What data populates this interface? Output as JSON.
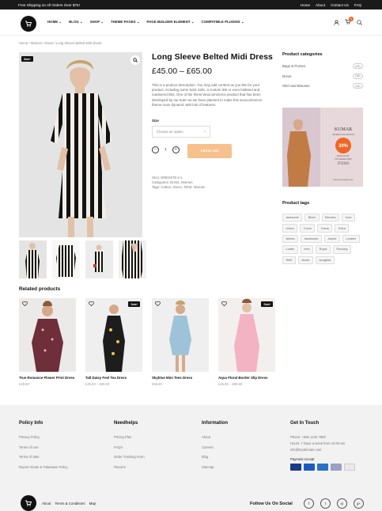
{
  "topbar": {
    "promo": "Free Shipping on All Orders Over $75!",
    "links": [
      "Home",
      "About",
      "Contact Us",
      "FAQ"
    ]
  },
  "nav": {
    "items": [
      "HOME",
      "BLOG",
      "SHOP",
      "THEME PAGES",
      "PAGE BUILDER ELEMENT",
      "COMPATIBLE PLUGINS"
    ],
    "cart_count": "0"
  },
  "breadcrumb": "Home / Women / Dress / Long Sleeve Belted Midi Dress",
  "product": {
    "sale_badge": "Sale!",
    "title": "Long Sleeve Belted Midi Dress",
    "price": "£45.00 – £65.00",
    "description": "This is a product description. You may add content as you like for your product, including some bold, italic, a custom link or even bulleted and numbered lists. One of the finest Woocommerce product that has been developed by our team as we have planned to make this woocommerce theme more dynamic with lots of features.",
    "size_label": "Size",
    "size_placeholder": "Choose an option",
    "qty": "1",
    "add_to_cart": "Add to cart",
    "sku": "SKU: DRESS75-2-1",
    "categories": "Categories: Dress, Women",
    "tags": "Tags: Cotton, Dress, Tshirt, Women"
  },
  "sidebar": {
    "categories_title": "Product categories",
    "categories": [
      {
        "name": "Bags & Purses",
        "count": "(29)"
      },
      {
        "name": "Dress",
        "count": "(16)"
      },
      {
        "name": "Shirt and Blouses",
        "count": "(16)"
      }
    ],
    "banner": {
      "brand": "KUMAR",
      "brand_sub": "WOMEN COLLECTION",
      "percent": "30%",
      "line1": "DISCOUNT",
      "line2": "ON SELECTED",
      "line3": "ITEMS",
      "url": "www.yourcompany.com"
    },
    "tags_title": "Product tags",
    "tags": [
      "awesome",
      "Black",
      "Blouses",
      "Cool",
      "cotton",
      "Curve",
      "Dress",
      "Extra",
      "fabrics",
      "handsome",
      "Jacket",
      "Leather",
      "Loafer",
      "men",
      "Royal",
      "Running",
      "Shirt",
      "shoes",
      "sunglass"
    ]
  },
  "related": {
    "title": "Related products",
    "items": [
      {
        "name": "True Romance Flower Print Dress",
        "price": "£49.69",
        "sale": false
      },
      {
        "name": "Tall Daisy Feel Tea Dress",
        "price": "£45.60 – £69.60",
        "sale": true
      },
      {
        "name": "Skyblue Mini Tees Dress",
        "price": "£58.60",
        "sale": false
      },
      {
        "name": "Aqua Floral Border Slip Dress",
        "price": "£45.60 – £69.60",
        "sale": true
      }
    ]
  },
  "footer": {
    "policy": {
      "title": "Policy Info",
      "items": [
        "Privacy Policy",
        "Terms of Use",
        "Terms of Sale",
        "Report Abuse & Takedown Policy"
      ]
    },
    "help": {
      "title": "Needhelps",
      "items": [
        "Pricing Plan",
        "FAQ's",
        "Order Tracking Form",
        "Returns"
      ]
    },
    "info": {
      "title": "Information",
      "items": [
        "About",
        "Careers",
        "Blog",
        "Sitemap"
      ]
    },
    "touch": {
      "title": "Get In Touch",
      "phone": "Phone: +555 1234 7800",
      "hours": "Hours: 7 Days a week from 10:00 am",
      "email": "info@mydomain.com",
      "payment_label": "Payment Accept"
    },
    "bottom_links": [
      "About",
      "Terms & Conditions",
      "Map"
    ],
    "follow": "Follow Us On Social"
  },
  "colors": {
    "accent": "#f26522",
    "button": "#f6c18d",
    "dark": "#111111",
    "footer_bg": "#f2f2f2"
  }
}
